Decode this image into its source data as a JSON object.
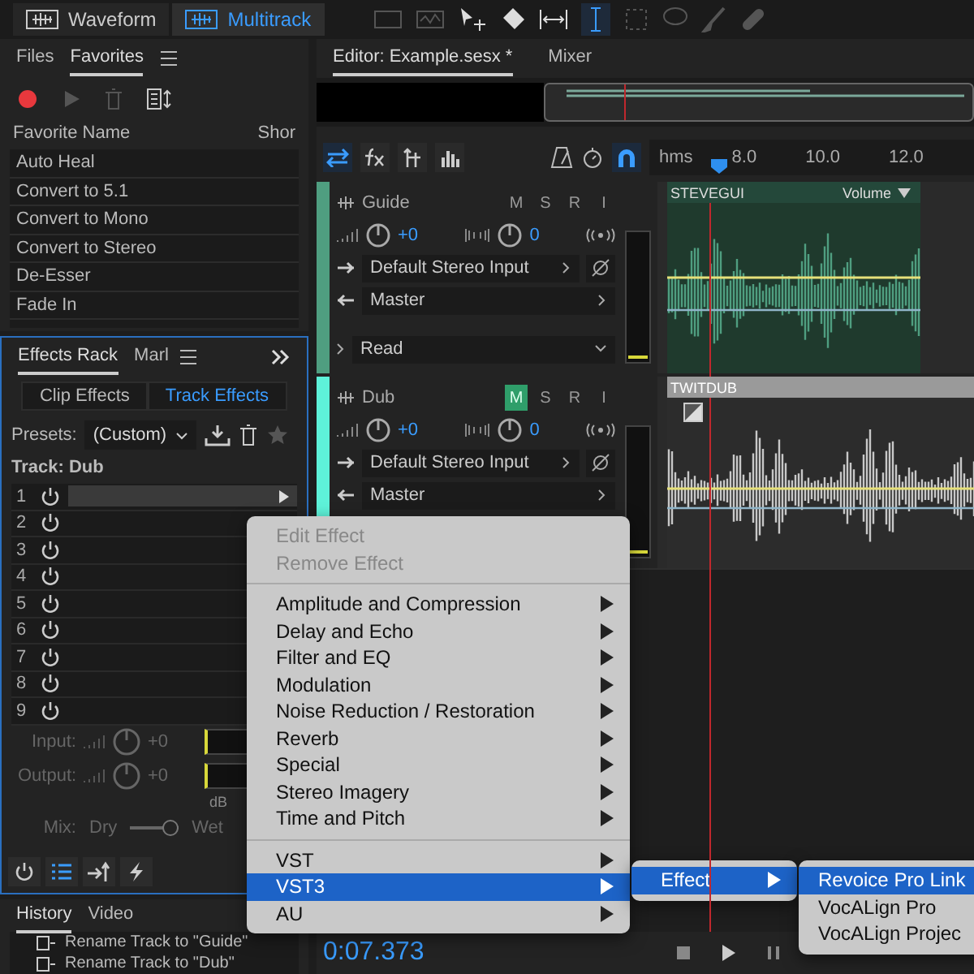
{
  "workspace_tabs": [
    {
      "label": "Waveform",
      "selected": false
    },
    {
      "label": "Multitrack",
      "selected": true
    }
  ],
  "files_panel": {
    "tabs": [
      {
        "label": "Files",
        "selected": false
      },
      {
        "label": "Favorites",
        "selected": true
      }
    ],
    "columns": [
      "Favorite Name",
      "Shor"
    ],
    "items": [
      "Auto Heal",
      "Convert to 5.1",
      "Convert to Mono",
      "Convert to Stereo",
      "De-Esser",
      "Fade In"
    ]
  },
  "effects_rack": {
    "tabs": [
      {
        "label": "Effects Rack",
        "selected": true
      },
      {
        "label": "Marl",
        "selected": false
      }
    ],
    "mode_tabs": [
      {
        "label": "Clip Effects",
        "selected": false
      },
      {
        "label": "Track Effects",
        "selected": true
      }
    ],
    "presets_label": "Presets:",
    "preset": "(Custom)",
    "track_label": "Track: Dub",
    "slots": [
      {
        "number": "1",
        "selected": true
      },
      {
        "number": "2",
        "selected": false
      },
      {
        "number": "3",
        "selected": false
      },
      {
        "number": "4",
        "selected": false
      },
      {
        "number": "5",
        "selected": false
      },
      {
        "number": "6",
        "selected": false
      },
      {
        "number": "7",
        "selected": false
      },
      {
        "number": "8",
        "selected": false
      },
      {
        "number": "9",
        "selected": false
      }
    ],
    "input": {
      "label": "Input:",
      "value": "+0"
    },
    "output": {
      "label": "Output:",
      "value": "+0"
    },
    "db_label": "dB",
    "mix": {
      "label": "Mix:",
      "dry": "Dry",
      "wet": "Wet",
      "level": 1
    }
  },
  "history": {
    "tabs": [
      {
        "label": "History",
        "selected": true
      },
      {
        "label": "Video",
        "selected": false
      }
    ],
    "items": [
      "Rename Track to \"Guide\"",
      "Rename Track to \"Dub\""
    ]
  },
  "editor": {
    "tabs": [
      {
        "label": "Editor: Example.sesx *",
        "selected": true
      },
      {
        "label": "Mixer",
        "selected": false
      }
    ],
    "ruler": {
      "unit": "hms",
      "ticks": [
        "8.0",
        "10.0",
        "12.0"
      ]
    },
    "tracks": [
      {
        "name": "Guide",
        "color": "#4f9e80",
        "buttons": [
          {
            "label": "M",
            "on": false
          },
          {
            "label": "S",
            "on": false
          },
          {
            "label": "R",
            "on": false
          },
          {
            "label": "I",
            "on": false
          }
        ],
        "volume": "+0",
        "pan": "0",
        "input": "Default Stereo Input",
        "output": "Master",
        "automation": "Read",
        "clip": {
          "name": "STEVEGUI",
          "label": "Volume",
          "selected": false
        }
      },
      {
        "name": "Dub",
        "color": "#5ef2d9",
        "buttons": [
          {
            "label": "M",
            "on": true
          },
          {
            "label": "S",
            "on": false
          },
          {
            "label": "R",
            "on": false
          },
          {
            "label": "I",
            "on": false
          }
        ],
        "volume": "+0",
        "pan": "0",
        "input": "Default Stereo Input",
        "output": "Master",
        "clip": {
          "name": "TWITDUB",
          "selected": true
        }
      }
    ],
    "time": "0:07.373"
  },
  "context_menu": {
    "groups": [
      [
        {
          "label": "Edit Effect",
          "disabled": true,
          "submenu": false,
          "selected": false
        },
        {
          "label": "Remove Effect",
          "disabled": true,
          "submenu": false,
          "selected": false
        }
      ],
      [
        {
          "label": "Amplitude and Compression",
          "disabled": false,
          "submenu": true,
          "selected": false
        },
        {
          "label": "Delay and Echo",
          "disabled": false,
          "submenu": true,
          "selected": false
        },
        {
          "label": "Filter and EQ",
          "disabled": false,
          "submenu": true,
          "selected": false
        },
        {
          "label": "Modulation",
          "disabled": false,
          "submenu": true,
          "selected": false
        },
        {
          "label": "Noise Reduction / Restoration",
          "disabled": false,
          "submenu": true,
          "selected": false
        },
        {
          "label": "Reverb",
          "disabled": false,
          "submenu": true,
          "selected": false
        },
        {
          "label": "Special",
          "disabled": false,
          "submenu": true,
          "selected": false
        },
        {
          "label": "Stereo Imagery",
          "disabled": false,
          "submenu": true,
          "selected": false
        },
        {
          "label": "Time and Pitch",
          "disabled": false,
          "submenu": true,
          "selected": false
        }
      ],
      [
        {
          "label": "VST",
          "disabled": false,
          "submenu": true,
          "selected": false
        },
        {
          "label": "VST3",
          "disabled": false,
          "submenu": true,
          "selected": true
        },
        {
          "label": "AU",
          "disabled": false,
          "submenu": true,
          "selected": false
        }
      ]
    ],
    "submenu": [
      {
        "label": "Effect",
        "submenu": true,
        "selected": true
      }
    ],
    "submenu2": [
      {
        "label": "Revoice Pro Link",
        "submenu": false,
        "selected": true
      },
      {
        "label": "VocALign Pro",
        "submenu": false,
        "selected": false
      },
      {
        "label": "VocALign Projec",
        "submenu": false,
        "selected": false
      }
    ]
  }
}
